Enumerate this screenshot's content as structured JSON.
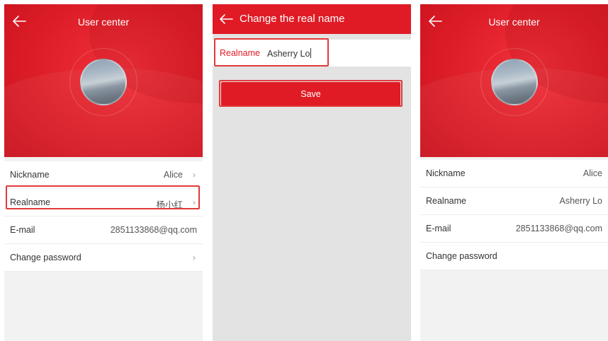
{
  "screens": {
    "user_center_before": {
      "title": "User center",
      "rows": [
        {
          "label": "Nickname",
          "value": "Alice",
          "arrow": "›"
        },
        {
          "label": "Realname",
          "value": "杨小红",
          "arrow": "›"
        },
        {
          "label": "E-mail",
          "value": "2851133868@qq.com",
          "arrow": ""
        },
        {
          "label": "Change password",
          "value": "",
          "arrow": "›"
        }
      ]
    },
    "change_real_name": {
      "title": "Change the real name",
      "field_label": "Realname",
      "field_value": "Asherry Lo",
      "save_label": "Save"
    },
    "user_center_after": {
      "title": "User center",
      "rows": [
        {
          "label": "Nickname",
          "value": "Alice"
        },
        {
          "label": "Realname",
          "value": "Asherry Lo"
        },
        {
          "label": "E-mail",
          "value": "2851133868@qq.com"
        },
        {
          "label": "Change password",
          "value": ""
        }
      ]
    }
  },
  "colors": {
    "primary_red": "#e01b25",
    "highlight_border": "#e23a3a"
  },
  "icons": {
    "back": "back-arrow-icon",
    "chevron": "chevron-right-icon"
  }
}
